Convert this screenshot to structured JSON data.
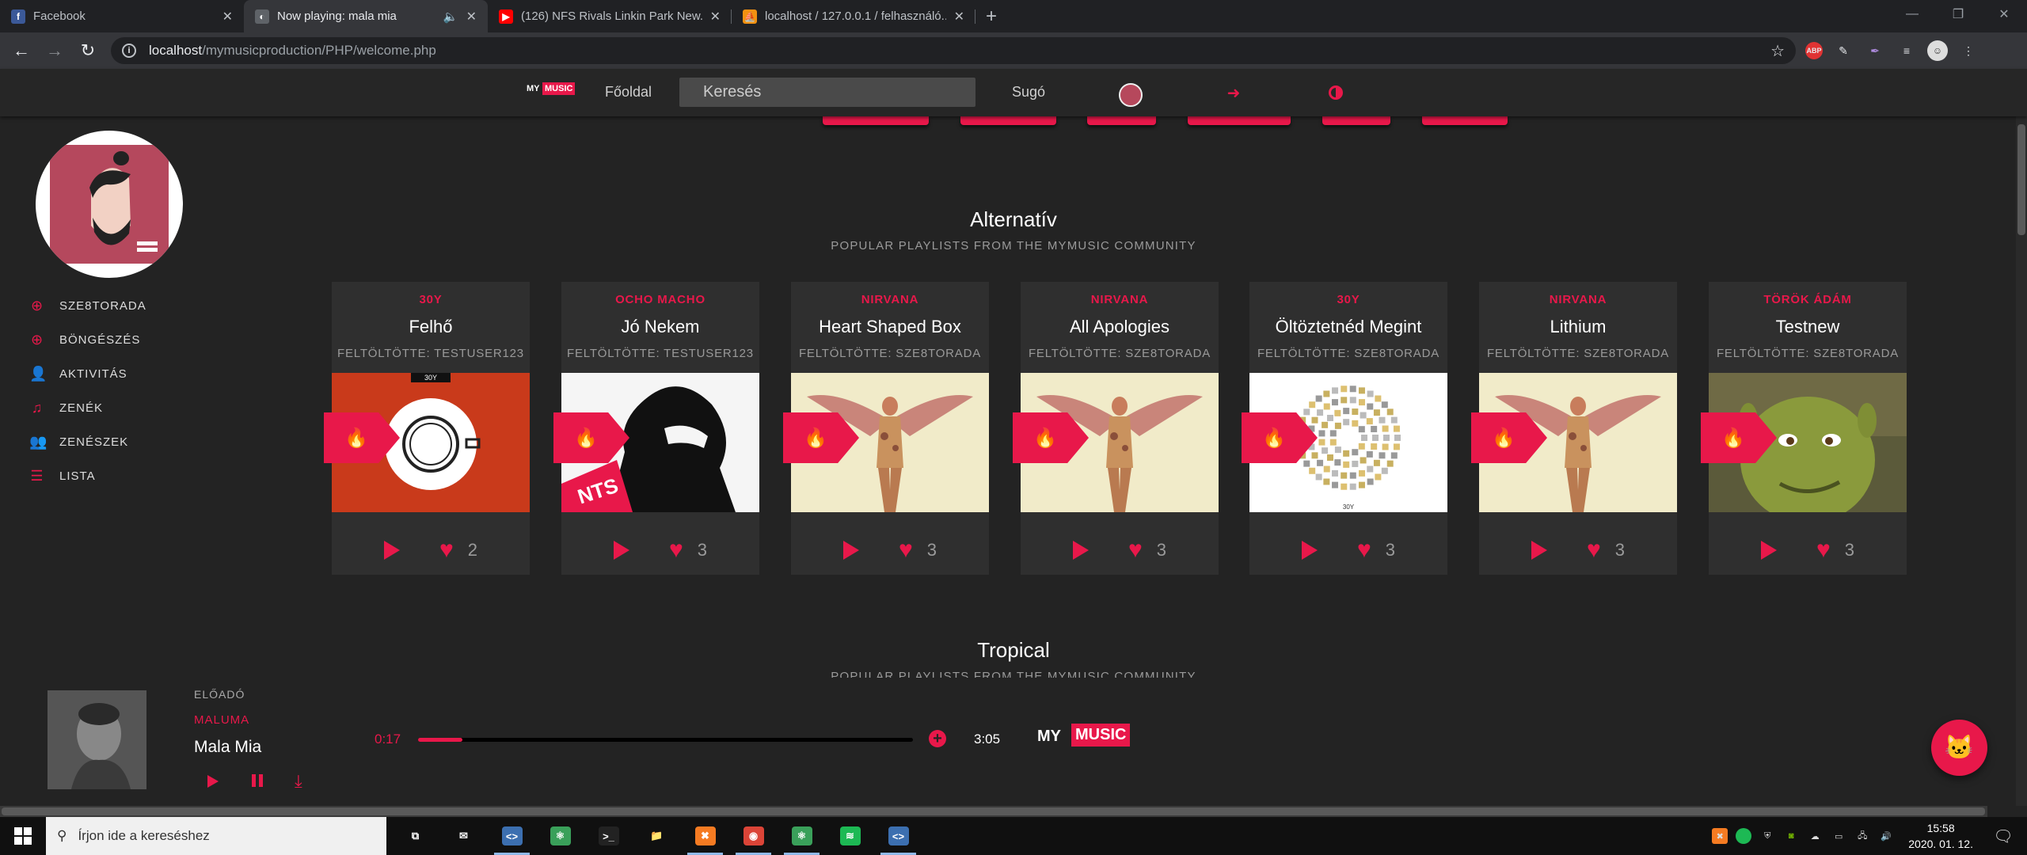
{
  "browser": {
    "tabs": [
      {
        "title": "Facebook",
        "icon": "facebook-icon",
        "color": "#3b5998",
        "glyph": "f"
      },
      {
        "title": "Now playing: mala mia",
        "icon": "globe-icon",
        "color": "#5f6368",
        "glyph": "◐",
        "audio": "🔈"
      },
      {
        "title": "(126) NFS Rivals Linkin Park New...",
        "icon": "youtube-icon",
        "color": "#ff0000",
        "glyph": "▶"
      },
      {
        "title": "localhost / 127.0.0.1 / felhasználó...",
        "icon": "phpmyadmin-icon",
        "color": "#f29111",
        "glyph": "⛵"
      }
    ],
    "new_tab": "+",
    "url_host": "localhost",
    "url_path": "/mymusicproduction/PHP/welcome.php",
    "abp": "ABP"
  },
  "site_nav": {
    "logo_my": "MY",
    "logo_music": "MUSIC",
    "home": "Főoldal",
    "search_placeholder": "Keresés",
    "help": "Sugó"
  },
  "sidebar": {
    "items": [
      {
        "label": "SZE8TORADA",
        "icon": "plus-circle-icon",
        "glyph": "⊕"
      },
      {
        "label": "BÖNGÉSZÉS",
        "icon": "plus-circle-icon",
        "glyph": "⊕"
      },
      {
        "label": "AKTIVITÁS",
        "icon": "user-icon",
        "glyph": "👤"
      },
      {
        "label": "ZENÉK",
        "icon": "music-note-icon",
        "glyph": "♫"
      },
      {
        "label": "ZENÉSZEK",
        "icon": "users-icon",
        "glyph": "👥"
      },
      {
        "label": "LISTA",
        "icon": "list-icon",
        "glyph": "☰"
      }
    ]
  },
  "section": {
    "title": "Alternatív",
    "subtitle": "POPULAR PLAYLISTS FROM THE MYMUSIC COMMUNITY",
    "next_title": "Tropical",
    "next_subtitle": "POPULAR PLAYLISTS FROM THE MYMUSIC COMMUNITY"
  },
  "cards": [
    {
      "artist": "30Y",
      "title": "Felhő",
      "uploader": "FELTÖLTÖTTE: TESTUSER123",
      "likes": "2",
      "cover": "cup"
    },
    {
      "artist": "OCHO MACHO",
      "title": "Jó Nekem",
      "uploader": "FELTÖLTÖTTE: TESTUSER123",
      "likes": "3",
      "cover": "sketch"
    },
    {
      "artist": "NIRVANA",
      "title": "Heart Shaped Box",
      "uploader": "FELTÖLTÖTTE: SZE8TORADA",
      "likes": "3",
      "cover": "angel"
    },
    {
      "artist": "NIRVANA",
      "title": "All Apologies",
      "uploader": "FELTÖLTÖTTE: SZE8TORADA",
      "likes": "3",
      "cover": "angel"
    },
    {
      "artist": "30Y",
      "title": "Öltöztetnéd Megint",
      "uploader": "FELTÖLTÖTTE: SZE8TORADA",
      "likes": "3",
      "cover": "ring"
    },
    {
      "artist": "NIRVANA",
      "title": "Lithium",
      "uploader": "FELTÖLTÖTTE: SZE8TORADA",
      "likes": "3",
      "cover": "angel"
    },
    {
      "artist": "TÖRÖK ÁDÁM",
      "title": "Testnew",
      "uploader": "FELTÖLTÖTTE: SZE8TORADA",
      "likes": "3",
      "cover": "shrek"
    }
  ],
  "cover_text": {
    "cup": "30Y",
    "ring": "30Y",
    "sketch": "NTS"
  },
  "player": {
    "label": "ELŐADÓ",
    "artist": "MALUMA",
    "song": "Mala Mia",
    "elapsed": "0:17",
    "duration": "3:05",
    "progress": 0.09
  },
  "taskbar": {
    "search_placeholder": "Írjon ide a kereséshez",
    "time": "15:58",
    "date": "2020. 01. 12.",
    "apps": [
      {
        "name": "task-view-icon",
        "glyph": "⧉",
        "color": "transparent",
        "open": false
      },
      {
        "name": "mail-icon",
        "glyph": "✉",
        "color": "transparent",
        "open": false
      },
      {
        "name": "vscode-icon",
        "glyph": "<>",
        "color": "#3c6fb0",
        "open": true
      },
      {
        "name": "atom-icon",
        "glyph": "⚛",
        "color": "#3aa05a",
        "open": false
      },
      {
        "name": "terminal-icon",
        "glyph": ">_",
        "color": "#222",
        "open": false
      },
      {
        "name": "folder-icon",
        "glyph": "📁",
        "color": "transparent",
        "open": false
      },
      {
        "name": "xampp-icon",
        "glyph": "✖",
        "color": "#f57b22",
        "open": true
      },
      {
        "name": "chrome-icon",
        "glyph": "◉",
        "color": "#db4437",
        "open": true
      },
      {
        "name": "atom-icon-2",
        "glyph": "⚛",
        "color": "#3aa05a",
        "open": true
      },
      {
        "name": "spotify-icon",
        "glyph": "≋",
        "color": "#1db954",
        "open": false
      },
      {
        "name": "vscode-icon-2",
        "glyph": "<>",
        "color": "#3c6fb0",
        "open": true
      }
    ]
  },
  "colors": {
    "accent": "#e8184a",
    "bg": "#232323",
    "card": "#2f2f2f"
  }
}
